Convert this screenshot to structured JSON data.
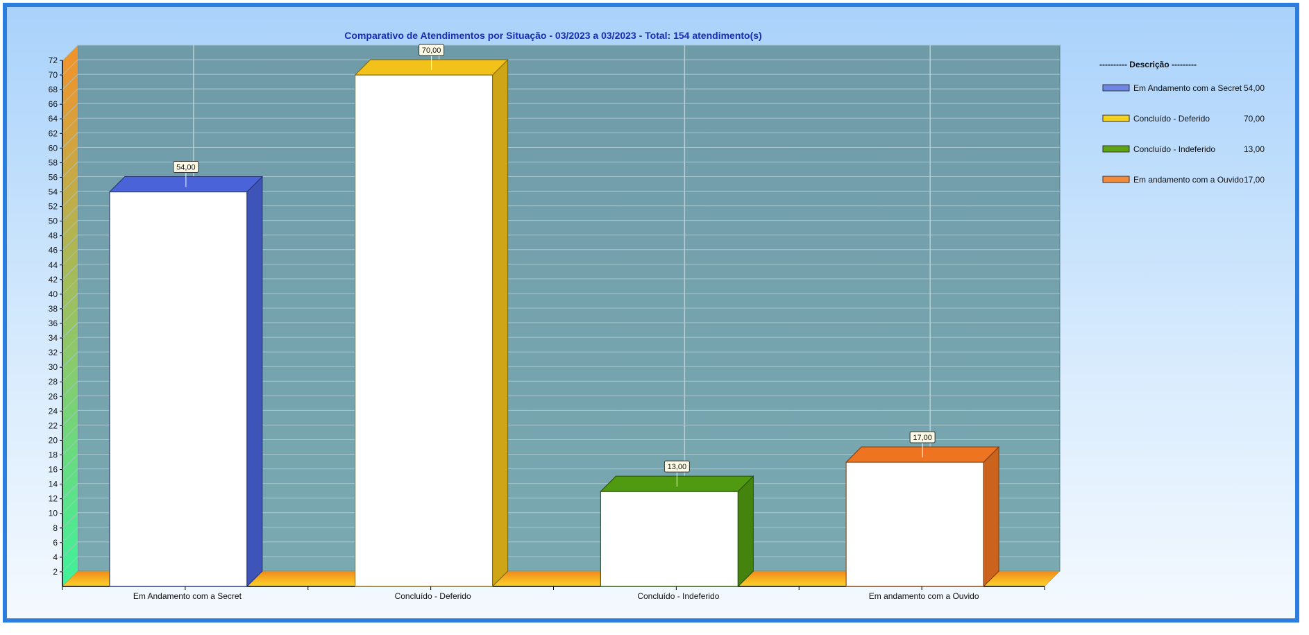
{
  "chart_data": {
    "type": "bar",
    "title": "Comparativo de Atendimentos por Situação - 03/2023 a 03/2023 - Total: 154 atendimento(s)",
    "categories": [
      "Em Andamento com a Secret",
      "Concluído - Deferido",
      "Concluído - Indeferido",
      "Em andamento com a Ouvido"
    ],
    "values": [
      54,
      70,
      13,
      17
    ],
    "value_labels": [
      "54,00",
      "70,00",
      "13,00",
      "17,00"
    ],
    "colors": [
      "#4a63d9",
      "#f2c21a",
      "#4f9a10",
      "#ef7421"
    ],
    "ylim": [
      0,
      72
    ],
    "y_ticks": [
      2,
      4,
      6,
      8,
      10,
      12,
      14,
      16,
      18,
      20,
      22,
      24,
      26,
      28,
      30,
      32,
      34,
      36,
      38,
      40,
      42,
      44,
      46,
      48,
      50,
      52,
      54,
      56,
      58,
      60,
      62,
      64,
      66,
      68,
      70,
      72
    ],
    "grid": true,
    "legend": {
      "position": "right",
      "title": "---------- Descrição ---------",
      "items": [
        {
          "label": "Em Andamento com a Secret",
          "value": "54,00",
          "color": "#6d86e6"
        },
        {
          "label": "Concluído - Deferido",
          "value": "70,00",
          "color": "#f6d21e"
        },
        {
          "label": "Concluído - Indeferido",
          "value": "13,00",
          "color": "#5ea611"
        },
        {
          "label": "Em andamento com a Ouvido",
          "value": "17,00",
          "color": "#f38a3a"
        }
      ]
    },
    "colors_theme": {
      "plot_bg": "#739eab",
      "floor": "#f7b816",
      "left_wall_top": "#f3922a",
      "left_wall_bottom": "#3ef29b"
    }
  }
}
